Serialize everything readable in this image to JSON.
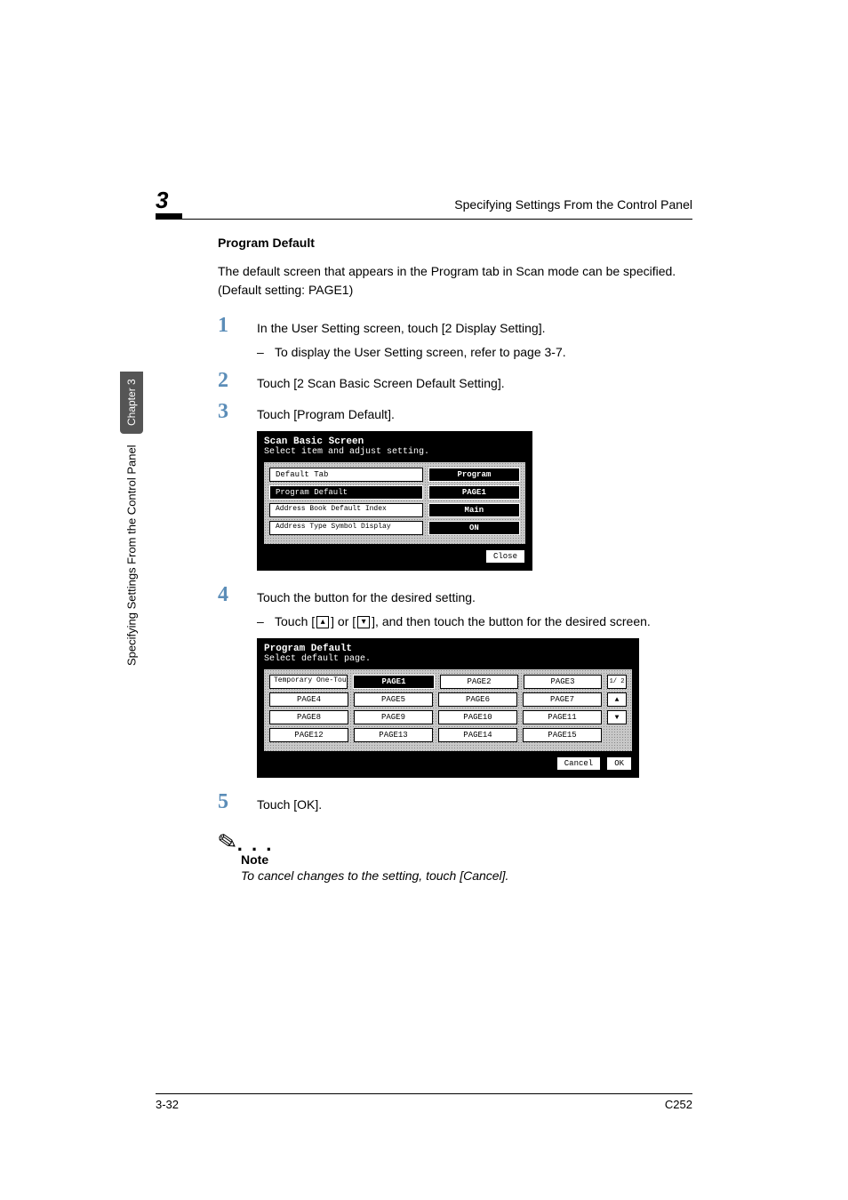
{
  "header": {
    "chapter_number": "3",
    "running_head": "Specifying Settings From the Control Panel"
  },
  "sidebar": {
    "tab_label": "Chapter 3",
    "vertical_text": "Specifying Settings From the Control Panel"
  },
  "section": {
    "title": "Program Default",
    "intro": "The default screen that appears in the Program tab in Scan mode can be specified. (Default setting: PAGE1)"
  },
  "steps": {
    "s1": {
      "num": "1",
      "text": "In the User Setting screen, touch [2 Display Setting].",
      "sub": "To display the User Setting screen, refer to page 3-7."
    },
    "s2": {
      "num": "2",
      "text": "Touch [2 Scan Basic Screen Default Setting]."
    },
    "s3": {
      "num": "3",
      "text": "Touch [Program Default]."
    },
    "s4": {
      "num": "4",
      "text": "Touch the button for the desired setting.",
      "sub_pre": "Touch [",
      "sub_mid": "] or [",
      "sub_post": "], and then touch the button for the desired screen."
    },
    "s5": {
      "num": "5",
      "text": "Touch [OK]."
    }
  },
  "shot1": {
    "title": "Scan Basic Screen",
    "subtitle": "Select item and adjust setting.",
    "rows": {
      "r1": {
        "label": "Default Tab",
        "value": "Program"
      },
      "r2": {
        "label": "Program Default",
        "value": "PAGE1"
      },
      "r3": {
        "label": "Address Book Default Index",
        "value": "Main"
      },
      "r4": {
        "label": "Address Type Symbol Display",
        "value": "ON"
      }
    },
    "close": "Close"
  },
  "shot2": {
    "title": "Program Default",
    "subtitle": "Select default page.",
    "cells": {
      "c0": "Temporary One-Touch",
      "c1": "PAGE1",
      "c2": "PAGE2",
      "c3": "PAGE3",
      "c4": "PAGE4",
      "c5": "PAGE5",
      "c6": "PAGE6",
      "c7": "PAGE7",
      "c8": "PAGE8",
      "c9": "PAGE9",
      "c10": "PAGE10",
      "c11": "PAGE11",
      "c12": "PAGE12",
      "c13": "PAGE13",
      "c14": "PAGE14",
      "c15": "PAGE15"
    },
    "pager_label": "1/ 2",
    "up": "▲",
    "down": "▼",
    "cancel": "Cancel",
    "ok": "OK"
  },
  "note": {
    "dots": ". . .",
    "head": "Note",
    "body": "To cancel changes to the setting, touch [Cancel]."
  },
  "footer": {
    "left": "3-32",
    "right": "C252"
  },
  "icons": {
    "up": "▴",
    "down": "▾"
  }
}
